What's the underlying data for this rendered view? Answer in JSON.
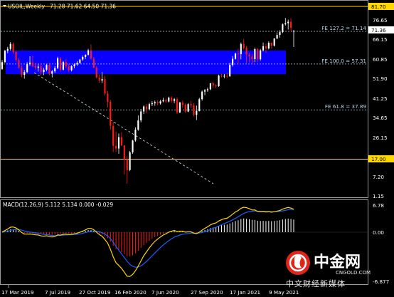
{
  "header": {
    "title_prefix": "USOIL,Weekly",
    "ohlc": "71.28 71.62 64.50 71.36"
  },
  "macd": {
    "label": "MACD(12,26,9) 5.112 5.134 0.000 -0.029",
    "ticks": [
      "6.78",
      "0.00",
      "-6.877"
    ]
  },
  "price_axis": {
    "ticks": [
      "76.65",
      "66.15",
      "60.85",
      "51.90",
      "41.25",
      "34.65",
      "26.15",
      "17.00",
      "7.20",
      "1.15"
    ],
    "markers": [
      {
        "value": "81.70",
        "color": "#ffd700"
      },
      {
        "value": "71.36",
        "color": "#ffffff"
      },
      {
        "value": "17.00",
        "color": "#ffd700"
      }
    ]
  },
  "time_axis": {
    "labels": [
      "17 Mar 2019",
      "7 Jul 2019",
      "27 Oct 2019",
      "16 Feb 2020",
      "7 Jun 2020",
      "27 Sep 2020",
      "17 Jan 2021",
      "9 May 2021"
    ]
  },
  "fib_levels": [
    {
      "label": "FE 127.2 = 71.14",
      "value": 71.14
    },
    {
      "label": "FE 100.0 = 57.31",
      "value": 57.31
    },
    {
      "label": "FE 61.8 = 37.89",
      "value": 37.89
    }
  ],
  "horizontal_lines": [
    {
      "value": 81.7,
      "color": "#ffd700"
    },
    {
      "value": 17.0,
      "color": "#ffd700"
    }
  ],
  "zone": {
    "from": 53.0,
    "to": 63.0,
    "color": "#0a00ff"
  },
  "watermark": {
    "cn": "中金网",
    "site": "CNGOLD.COM",
    "line": "中文财经新媒体"
  },
  "colors": {
    "bull": "#ffffff",
    "bear": "#ff1a1a",
    "macd_line": "#ffd700",
    "signal_line": "#1f5bff",
    "trend": "#cccccc",
    "background": "#000000"
  },
  "chart_data": {
    "type": "candlestick",
    "timeframe": "Weekly",
    "symbol": "USOIL",
    "ylim": [
      1.15,
      81.7
    ],
    "candles": [
      [
        55.2,
        59.0,
        54.8,
        58.1
      ],
      [
        58.1,
        63.3,
        57.8,
        62.9
      ],
      [
        62.9,
        64.6,
        61.9,
        63.7
      ],
      [
        63.7,
        66.6,
        63.0,
        65.8
      ],
      [
        65.8,
        66.4,
        61.6,
        62.4
      ],
      [
        62.4,
        63.0,
        58.2,
        59.0
      ],
      [
        59.0,
        59.9,
        55.2,
        55.8
      ],
      [
        55.8,
        56.7,
        51.6,
        52.7
      ],
      [
        52.7,
        54.8,
        51.1,
        53.9
      ],
      [
        53.9,
        58.1,
        53.4,
        57.3
      ],
      [
        57.3,
        60.6,
        56.6,
        57.9
      ],
      [
        57.9,
        60.8,
        55.9,
        56.5
      ],
      [
        56.5,
        57.7,
        54.9,
        55.7
      ],
      [
        55.7,
        57.2,
        54.1,
        56.2
      ],
      [
        56.2,
        57.6,
        52.5,
        53.9
      ],
      [
        53.9,
        55.7,
        52.6,
        54.9
      ],
      [
        54.9,
        57.4,
        54.2,
        56.9
      ],
      [
        56.9,
        57.8,
        52.6,
        53.2
      ],
      [
        53.2,
        54.8,
        51.6,
        54.2
      ],
      [
        54.2,
        56.4,
        53.6,
        55.6
      ],
      [
        55.6,
        60.4,
        55.1,
        59.7
      ],
      [
        59.7,
        60.2,
        54.1,
        54.9
      ],
      [
        54.9,
        58.6,
        54.6,
        58.1
      ],
      [
        58.1,
        59.4,
        55.5,
        56.3
      ],
      [
        56.3,
        57.4,
        53.9,
        54.7
      ],
      [
        54.7,
        56.8,
        54.2,
        56.4
      ],
      [
        56.4,
        57.6,
        55.5,
        57.1
      ],
      [
        57.1,
        58.5,
        56.5,
        57.8
      ],
      [
        57.8,
        59.5,
        57.4,
        59.2
      ],
      [
        59.2,
        60.9,
        58.6,
        60.3
      ],
      [
        60.3,
        61.4,
        59.4,
        61.2
      ],
      [
        61.2,
        63.7,
        60.9,
        63.1
      ],
      [
        63.1,
        65.6,
        59.2,
        59.6
      ],
      [
        59.6,
        60.3,
        55.4,
        55.8
      ],
      [
        55.8,
        56.4,
        51.2,
        51.6
      ],
      [
        51.6,
        52.9,
        49.4,
        50.3
      ],
      [
        50.3,
        53.9,
        49.2,
        50.9
      ],
      [
        50.9,
        52.2,
        44.0,
        44.8
      ],
      [
        44.8,
        45.9,
        38.9,
        41.3
      ],
      [
        41.3,
        42.1,
        29.4,
        31.1
      ],
      [
        31.1,
        32.8,
        20.0,
        22.6
      ],
      [
        22.6,
        28.7,
        20.1,
        21.5
      ],
      [
        21.5,
        27.9,
        19.3,
        26.3
      ],
      [
        26.3,
        28.4,
        22.6,
        22.8
      ],
      [
        22.8,
        23.0,
        10.5,
        17.0
      ],
      [
        17.0,
        18.2,
        6.5,
        12.4
      ],
      [
        12.4,
        20.5,
        11.9,
        19.9
      ],
      [
        19.9,
        25.2,
        19.3,
        24.9
      ],
      [
        24.9,
        30.5,
        24.4,
        29.5
      ],
      [
        29.5,
        35.5,
        29.0,
        33.4
      ],
      [
        33.4,
        38.2,
        32.6,
        37.2
      ],
      [
        37.2,
        39.8,
        36.1,
        39.3
      ],
      [
        39.3,
        40.3,
        36.4,
        38.2
      ],
      [
        38.2,
        40.9,
        37.9,
        40.3
      ],
      [
        40.3,
        41.6,
        39.5,
        40.7
      ],
      [
        40.7,
        41.8,
        39.6,
        41.2
      ],
      [
        41.2,
        42.0,
        39.8,
        40.6
      ],
      [
        40.6,
        42.1,
        40.1,
        41.5
      ],
      [
        41.5,
        43.0,
        41.1,
        42.0
      ],
      [
        42.0,
        42.6,
        40.9,
        41.4
      ],
      [
        41.4,
        43.5,
        41.0,
        43.1
      ],
      [
        43.1,
        43.7,
        40.9,
        41.7
      ],
      [
        41.7,
        42.9,
        40.7,
        42.4
      ],
      [
        42.4,
        43.2,
        36.1,
        36.8
      ],
      [
        36.8,
        41.3,
        36.5,
        41.0
      ],
      [
        41.0,
        41.8,
        38.7,
        40.1
      ],
      [
        40.1,
        40.6,
        36.7,
        37.2
      ],
      [
        37.2,
        40.8,
        36.9,
        40.3
      ],
      [
        40.3,
        41.7,
        38.6,
        39.8
      ],
      [
        39.8,
        40.7,
        35.1,
        35.8
      ],
      [
        35.8,
        39.7,
        33.6,
        37.4
      ],
      [
        37.4,
        43.0,
        37.2,
        42.4
      ],
      [
        42.4,
        46.1,
        41.8,
        45.6
      ],
      [
        45.6,
        46.7,
        44.1,
        46.2
      ],
      [
        46.2,
        47.3,
        45.5,
        46.6
      ],
      [
        46.6,
        49.3,
        46.2,
        49.1
      ],
      [
        49.1,
        49.8,
        47.0,
        48.2
      ],
      [
        48.2,
        48.7,
        47.1,
        47.9
      ],
      [
        47.9,
        52.8,
        47.6,
        52.4
      ],
      [
        52.4,
        53.2,
        51.6,
        52.2
      ],
      [
        52.2,
        53.1,
        51.3,
        52.3
      ],
      [
        52.3,
        53.6,
        51.4,
        52.1
      ],
      [
        52.1,
        57.9,
        51.9,
        56.9
      ],
      [
        56.9,
        60.7,
        56.2,
        59.5
      ],
      [
        59.5,
        62.1,
        59.2,
        61.7
      ],
      [
        61.7,
        63.8,
        57.3,
        61.5
      ],
      [
        61.5,
        66.4,
        59.3,
        65.8
      ],
      [
        65.8,
        67.9,
        63.5,
        64.1
      ],
      [
        64.1,
        64.9,
        57.3,
        61.3
      ],
      [
        61.3,
        62.0,
        58.1,
        60.5
      ],
      [
        60.5,
        61.4,
        57.6,
        59.4
      ],
      [
        59.4,
        64.3,
        58.1,
        63.6
      ],
      [
        63.6,
        64.2,
        58.1,
        59.3
      ],
      [
        59.3,
        63.7,
        58.8,
        63.1
      ],
      [
        63.1,
        66.4,
        62.6,
        64.8
      ],
      [
        64.8,
        65.9,
        62.0,
        63.9
      ],
      [
        63.9,
        66.9,
        63.5,
        66.3
      ],
      [
        66.3,
        66.5,
        63.8,
        65.1
      ],
      [
        65.1,
        68.3,
        64.7,
        68.1
      ],
      [
        68.1,
        70.7,
        67.8,
        69.6
      ],
      [
        69.6,
        71.6,
        68.5,
        70.8
      ],
      [
        70.8,
        74.5,
        70.4,
        74.1
      ],
      [
        74.1,
        76.8,
        73.6,
        74.6
      ],
      [
        74.6,
        76.1,
        71.9,
        75.2
      ],
      [
        75.2,
        76.7,
        71.2,
        72.6
      ],
      [
        71.28,
        71.62,
        64.5,
        71.36
      ]
    ]
  }
}
